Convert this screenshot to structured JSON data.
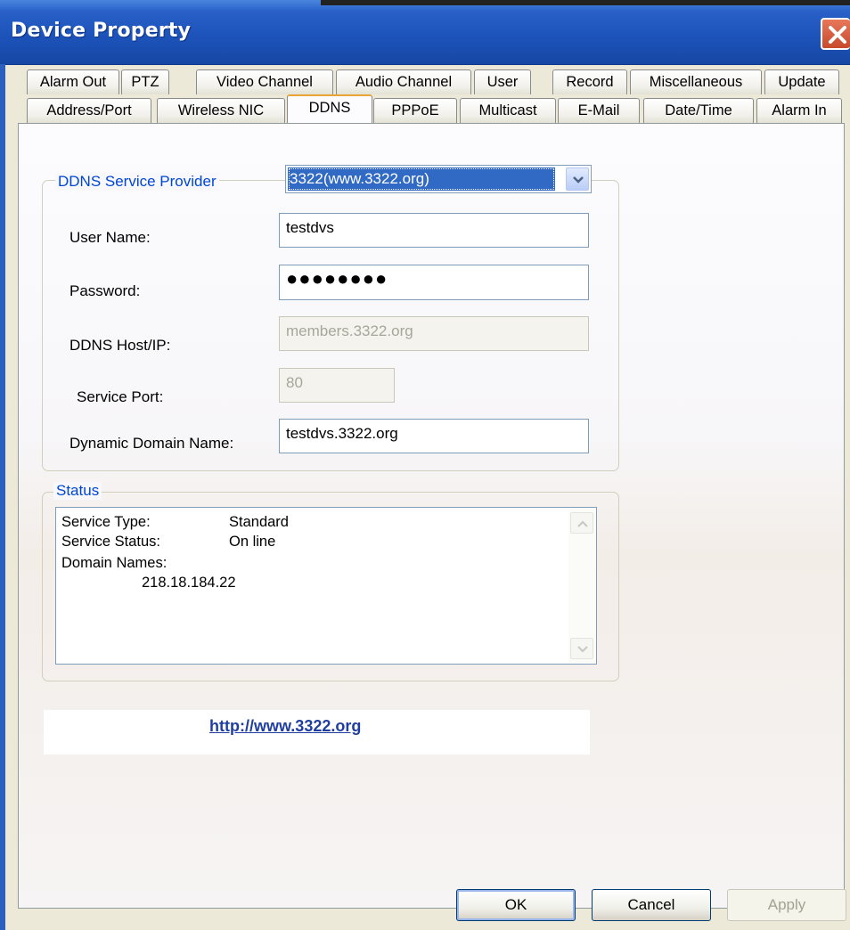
{
  "window": {
    "title": "Device Property"
  },
  "tabs": {
    "row1": [
      "Alarm Out",
      "PTZ",
      "Video Channel",
      "Audio Channel",
      "User",
      "Record",
      "Miscellaneous",
      "Update"
    ],
    "row2": [
      "Address/Port",
      "Wireless NIC",
      "DDNS",
      "PPPoE",
      "Multicast",
      "E-Mail",
      "Date/Time",
      "Alarm In"
    ],
    "active": "DDNS"
  },
  "ddns": {
    "group_label": "DDNS Service Provider",
    "provider": "3322(www.3322.org)",
    "user_name_label": "User Name:",
    "user_name": "testdvs",
    "password_label": "Password:",
    "password": "●●●●●●●●",
    "host_label": "DDNS Host/IP:",
    "host": "members.3322.org",
    "port_label": "Service Port:",
    "port": "80",
    "domain_label": "Dynamic Domain Name:",
    "domain": "testdvs.3322.org"
  },
  "status": {
    "group_label": "Status",
    "service_type_label": "Service Type:",
    "service_type": "Standard",
    "service_status_label": "Service Status:",
    "service_status": "On line",
    "domain_names_label": "Domain Names:",
    "domain_ip": "218.18.184.22"
  },
  "link": {
    "text": "http://www.3322.org"
  },
  "buttons": {
    "ok": "OK",
    "cancel": "Cancel",
    "apply": "Apply"
  },
  "colors": {
    "titlebar": "#1c52b8",
    "group_label": "#0046d5",
    "selection": "#316ac5",
    "link": "#1f3ea0",
    "close": "#c84a2c"
  },
  "icons": {
    "close": "close-icon",
    "dropdown": "chevron-down-icon",
    "scroll_up": "scroll-up-icon",
    "scroll_down": "scroll-down-icon"
  }
}
